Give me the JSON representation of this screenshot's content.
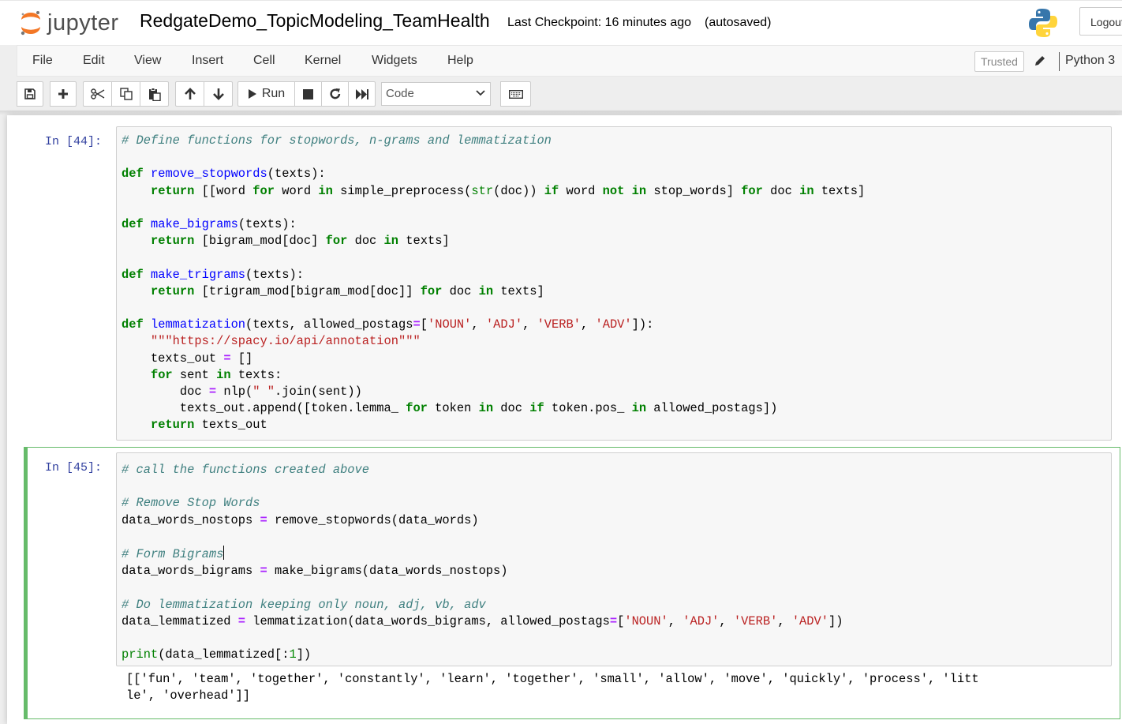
{
  "header": {
    "logo_text": "jupyter",
    "notebook_name": "RedgateDemo_TopicModeling_TeamHealth",
    "checkpoint": "Last Checkpoint: 16 minutes ago",
    "autosave": "(autosaved)",
    "logout_label": "Logout"
  },
  "menubar": {
    "items": [
      "File",
      "Edit",
      "View",
      "Insert",
      "Cell",
      "Kernel",
      "Widgets",
      "Help"
    ],
    "trusted_label": "Trusted",
    "kernel_name": "Python 3"
  },
  "toolbar": {
    "run_label": "Run",
    "cell_type": "Code",
    "icons": [
      "save-icon",
      "plus-icon",
      "cut-icon",
      "copy-icon",
      "paste-icon",
      "arrow-up-icon",
      "arrow-down-icon",
      "play-icon",
      "stop-icon",
      "restart-icon",
      "fast-forward-icon",
      "keyboard-icon"
    ]
  },
  "cells": [
    {
      "prompt": "In [44]:",
      "lines": [
        "# Define functions for stopwords, n-grams and lemmatization",
        "",
        "def remove_stopwords(texts):",
        "    return [[word for word in simple_preprocess(str(doc)) if word not in stop_words] for doc in texts]",
        "",
        "def make_bigrams(texts):",
        "    return [bigram_mod[doc] for doc in texts]",
        "",
        "def make_trigrams(texts):",
        "    return [trigram_mod[bigram_mod[doc]] for doc in texts]",
        "",
        "def lemmatization(texts, allowed_postags=['NOUN', 'ADJ', 'VERB', 'ADV']):",
        "    \"\"\"https://spacy.io/api/annotation\"\"\"",
        "    texts_out = []",
        "    for sent in texts:",
        "        doc = nlp(\" \".join(sent))",
        "        texts_out.append([token.lemma_ for token in doc if token.pos_ in allowed_postags])",
        "    return texts_out"
      ]
    },
    {
      "prompt": "In [45]:",
      "lines": [
        "# call the functions created above",
        "",
        "# Remove Stop Words",
        "data_words_nostops = remove_stopwords(data_words)",
        "",
        "# Form Bigrams",
        "data_words_bigrams = make_bigrams(data_words_nostops)",
        "",
        "# Do lemmatization keeping only noun, adj, vb, adv",
        "data_lemmatized = lemmatization(data_words_bigrams, allowed_postags=['NOUN', 'ADJ', 'VERB', 'ADV'])",
        "",
        "print(data_lemmatized[:1])"
      ],
      "cursor_line": 5,
      "output": [
        "[['fun', 'team', 'together', 'constantly', 'learn', 'together', 'small', 'allow', 'move', 'quickly', 'process', 'litt",
        "le', 'overhead']]"
      ]
    }
  ]
}
